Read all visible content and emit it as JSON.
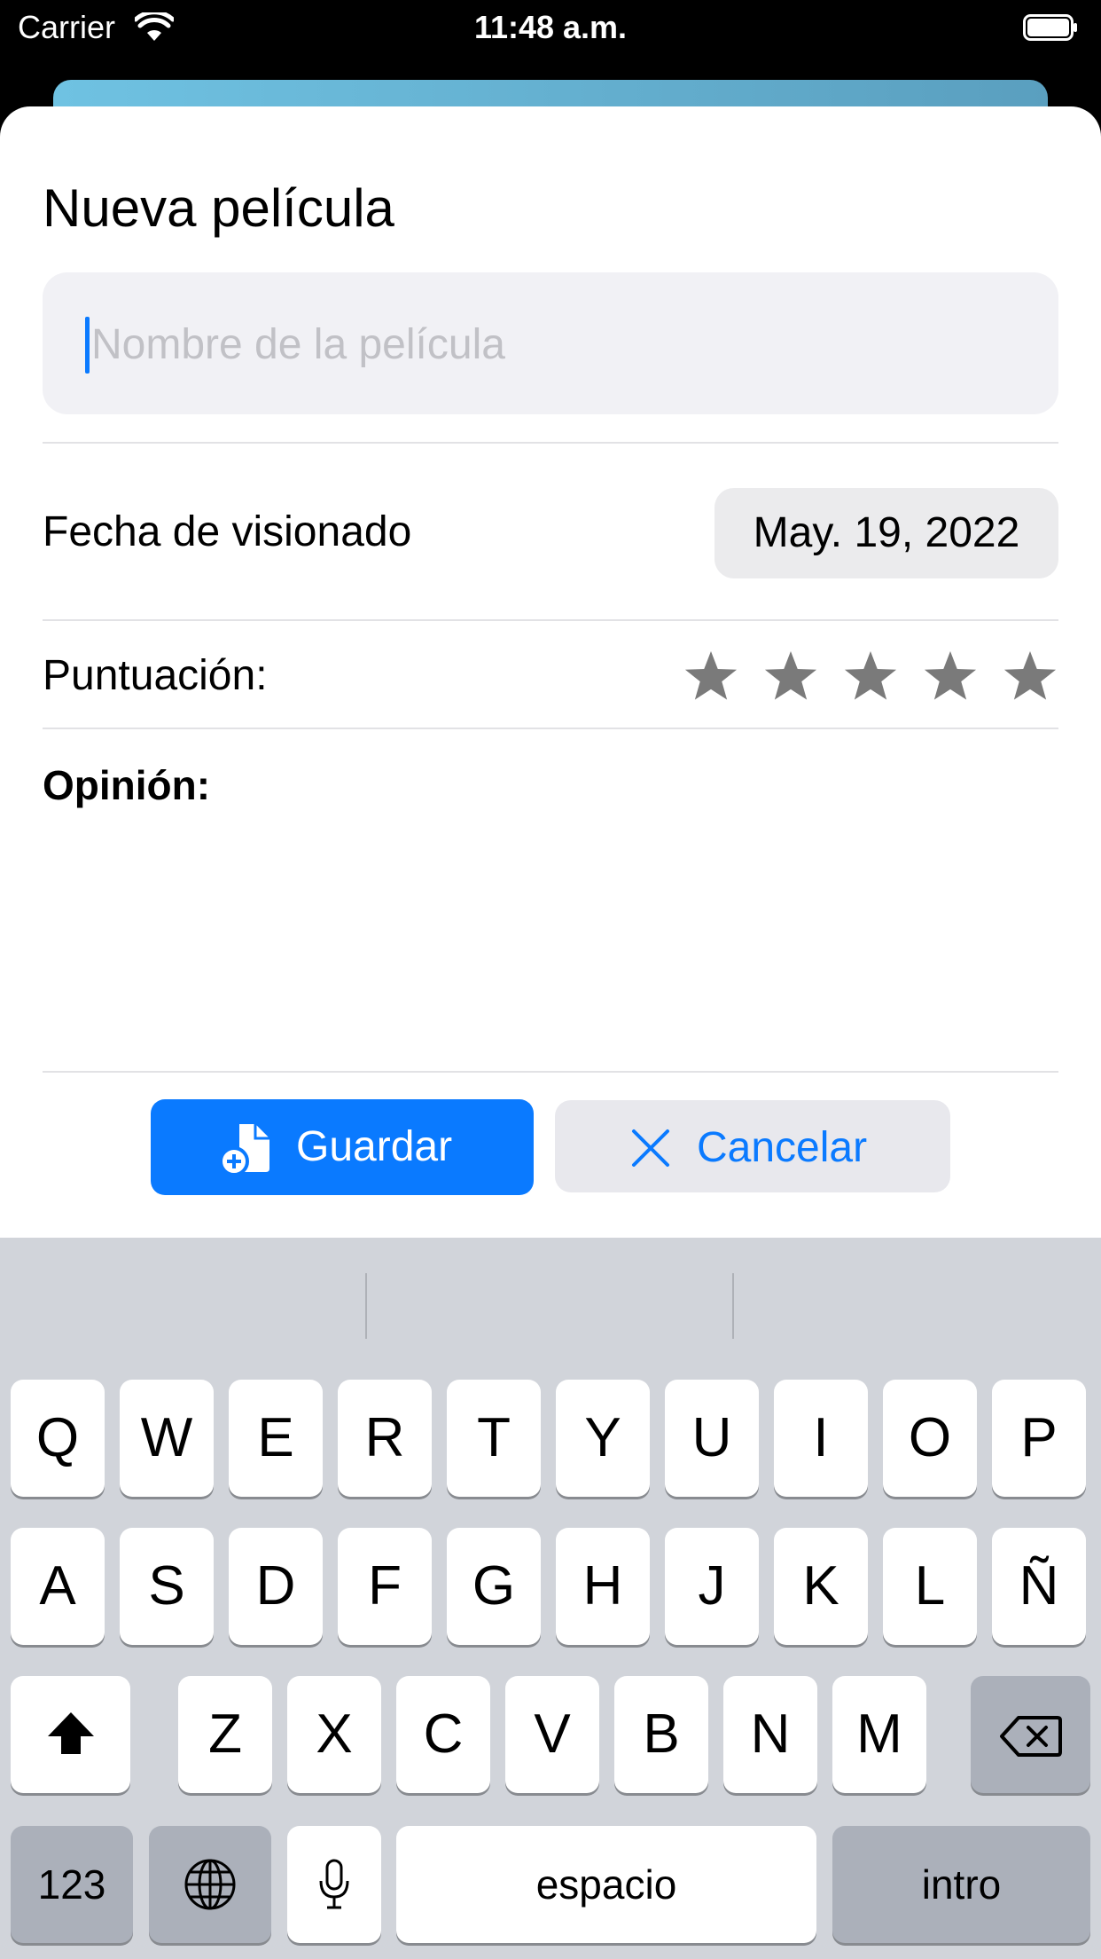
{
  "status_bar": {
    "carrier": "Carrier",
    "time": "11:48 a.m."
  },
  "form": {
    "title": "Nueva película",
    "name_placeholder": "Nombre de la película",
    "date_label": "Fecha de visionado",
    "date_value": "May. 19, 2022",
    "rating_label": "Puntuación:",
    "rating": {
      "value": 0,
      "max": 5
    },
    "opinion_label": "Opinión:",
    "opinion_text": ""
  },
  "buttons": {
    "save": "Guardar",
    "cancel": "Cancelar"
  },
  "colors": {
    "accent": "#0a7aff",
    "star": "#7a7a7a"
  },
  "keyboard": {
    "row1": [
      "Q",
      "W",
      "E",
      "R",
      "T",
      "Y",
      "U",
      "I",
      "O",
      "P"
    ],
    "row2": [
      "A",
      "S",
      "D",
      "F",
      "G",
      "H",
      "J",
      "K",
      "L",
      "Ñ"
    ],
    "row3": [
      "Z",
      "X",
      "C",
      "V",
      "B",
      "N",
      "M"
    ],
    "numbers": "123",
    "space": "espacio",
    "return": "intro"
  }
}
